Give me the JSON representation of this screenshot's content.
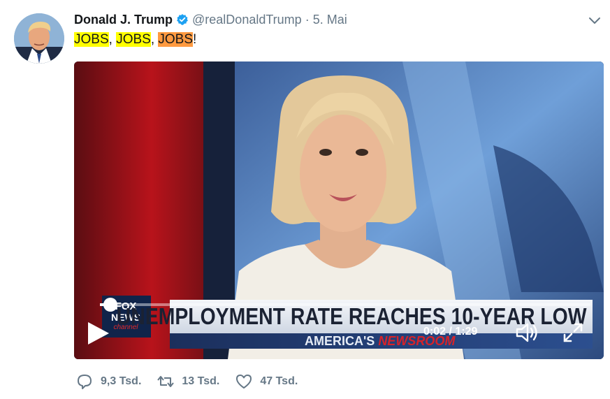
{
  "tweet": {
    "author_name": "Donald J. Trump",
    "handle": "@realDonaldTrump",
    "separator": "·",
    "date": "5. Mai",
    "text_parts": [
      "JOBS",
      ", ",
      "JOBS",
      ", ",
      "JOBS",
      "!"
    ],
    "verified_color": "#1da1f2"
  },
  "video": {
    "headline": "UNEMPLOYMENT RATE REACHES 10-YEAR LOW",
    "program_part1": "AMERICA'S",
    "program_part2": "NEWSROOM",
    "channel_logo_line1": "FOX",
    "channel_logo_line2": "NEWS",
    "channel_logo_line3": "channel",
    "time_display": "0:02 / 1:29",
    "progress": 0.022
  },
  "actions": {
    "replies": "9,3 Tsd.",
    "retweets": "13 Tsd.",
    "likes": "47 Tsd."
  },
  "icons": [
    "verified-badge-icon",
    "chevron-down-icon",
    "play-icon",
    "volume-icon",
    "fullscreen-icon",
    "reply-icon",
    "retweet-icon",
    "like-icon"
  ],
  "colors": {
    "secondary_text": "#657786",
    "highlight_yellow": "#ffff00",
    "highlight_orange": "#ff9a40"
  }
}
